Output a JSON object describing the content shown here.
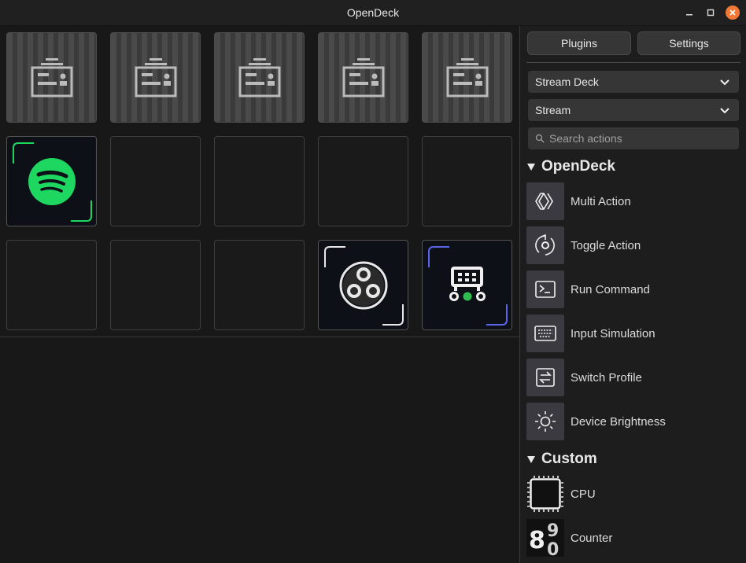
{
  "window": {
    "title": "OpenDeck"
  },
  "deck": {
    "keys": [
      {
        "row": 0,
        "col": 0,
        "state": "placeholder"
      },
      {
        "row": 0,
        "col": 1,
        "state": "placeholder"
      },
      {
        "row": 0,
        "col": 2,
        "state": "placeholder"
      },
      {
        "row": 0,
        "col": 3,
        "state": "placeholder"
      },
      {
        "row": 0,
        "col": 4,
        "state": "placeholder"
      },
      {
        "row": 1,
        "col": 0,
        "state": "spotify"
      },
      {
        "row": 1,
        "col": 1,
        "state": "empty"
      },
      {
        "row": 1,
        "col": 2,
        "state": "empty"
      },
      {
        "row": 1,
        "col": 3,
        "state": "empty"
      },
      {
        "row": 1,
        "col": 4,
        "state": "empty"
      },
      {
        "row": 2,
        "col": 0,
        "state": "empty"
      },
      {
        "row": 2,
        "col": 1,
        "state": "empty"
      },
      {
        "row": 2,
        "col": 2,
        "state": "empty"
      },
      {
        "row": 2,
        "col": 3,
        "state": "obs"
      },
      {
        "row": 2,
        "col": 4,
        "state": "keyboard"
      }
    ]
  },
  "panel": {
    "plugins_label": "Plugins",
    "settings_label": "Settings",
    "device_select": "Stream Deck",
    "profile_select": "Stream",
    "search_placeholder": "Search actions",
    "sections": [
      {
        "title": "OpenDeck",
        "actions": [
          {
            "label": "Multi Action",
            "icon": "multi-action-icon"
          },
          {
            "label": "Toggle Action",
            "icon": "toggle-action-icon"
          },
          {
            "label": "Run Command",
            "icon": "terminal-icon"
          },
          {
            "label": "Input Simulation",
            "icon": "keyboard-icon"
          },
          {
            "label": "Switch Profile",
            "icon": "switch-profile-icon"
          },
          {
            "label": "Device Brightness",
            "icon": "brightness-icon"
          }
        ]
      },
      {
        "title": "Custom",
        "actions": [
          {
            "label": "CPU",
            "icon": "cpu-chip-icon"
          },
          {
            "label": "Counter",
            "icon": "counter-icon"
          }
        ]
      }
    ]
  },
  "colors": {
    "spotify_green": "#1ed760",
    "obs_white": "#e8e8e8",
    "keyboard_accent": "#5b63e6",
    "close_button": "#f27835"
  }
}
